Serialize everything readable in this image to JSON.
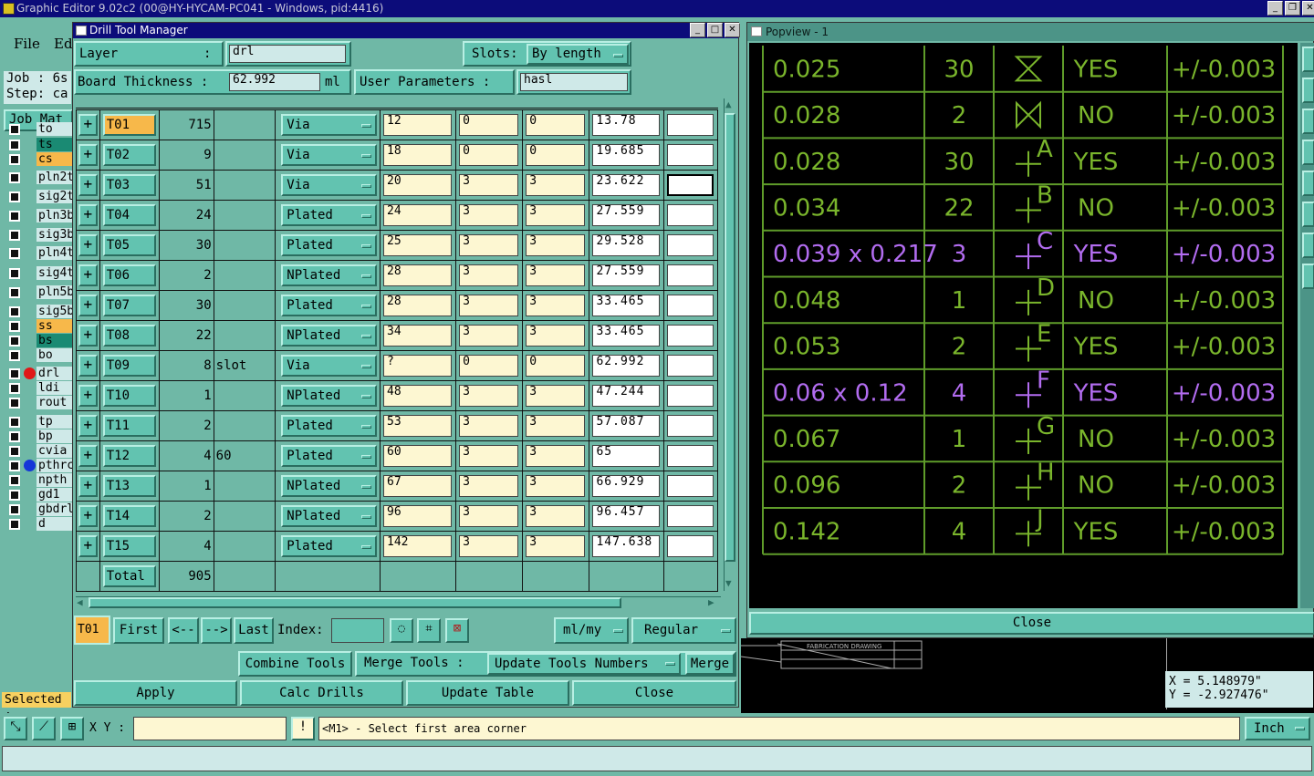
{
  "app_title": "Graphic Editor 9.02c2 (00@HY-HYCAM-PC041 - Windows, pid:4416)",
  "menu": {
    "file": "File",
    "edit": "Ed"
  },
  "job_label": "Job : 6s",
  "step_label": "Step: ca",
  "job_matrix": "Job Mat",
  "layers": [
    "to",
    "ts",
    "cs",
    "pln2t",
    "sig2t",
    "pln3b",
    "sig3b",
    "pln4t",
    "sig4t",
    "pln5b",
    "sig5b",
    "ss",
    "bs",
    "bo",
    "drl",
    "ldi",
    "rout",
    "tp",
    "bp",
    "cvia",
    "pthrc",
    "npth",
    "gd1",
    "gbdrl",
    "d"
  ],
  "selected_label": "Selected :",
  "dialog": {
    "title": "Drill Tool Manager",
    "layer_label": "Layer",
    "layer_colon": ":",
    "layer_value": "drl",
    "slots_label": "Slots:",
    "slots_value": "By length",
    "thickness_label": "Board Thickness :",
    "thickness_value": "62.992",
    "thickness_unit": "ml",
    "user_params_label": "User Parameters :",
    "user_params_value": "hasl",
    "rows": [
      {
        "tool": "T01",
        "count": "715",
        "slot": "",
        "type": "Via",
        "size": "12",
        "p1": "0",
        "p2": "0",
        "finish": "13.78"
      },
      {
        "tool": "T02",
        "count": "9",
        "slot": "",
        "type": "Via",
        "size": "18",
        "p1": "0",
        "p2": "0",
        "finish": "19.685"
      },
      {
        "tool": "T03",
        "count": "51",
        "slot": "",
        "type": "Via",
        "size": "20",
        "p1": "3",
        "p2": "3",
        "finish": "23.622"
      },
      {
        "tool": "T04",
        "count": "24",
        "slot": "",
        "type": "Plated",
        "size": "24",
        "p1": "3",
        "p2": "3",
        "finish": "27.559"
      },
      {
        "tool": "T05",
        "count": "30",
        "slot": "",
        "type": "Plated",
        "size": "25",
        "p1": "3",
        "p2": "3",
        "finish": "29.528"
      },
      {
        "tool": "T06",
        "count": "2",
        "slot": "",
        "type": "NPlated",
        "size": "28",
        "p1": "3",
        "p2": "3",
        "finish": "27.559"
      },
      {
        "tool": "T07",
        "count": "30",
        "slot": "",
        "type": "Plated",
        "size": "28",
        "p1": "3",
        "p2": "3",
        "finish": "33.465"
      },
      {
        "tool": "T08",
        "count": "22",
        "slot": "",
        "type": "NPlated",
        "size": "34",
        "p1": "3",
        "p2": "3",
        "finish": "33.465"
      },
      {
        "tool": "T09",
        "count": "8",
        "slot": "slot",
        "type": "Via",
        "size": "?",
        "p1": "0",
        "p2": "0",
        "finish": "62.992"
      },
      {
        "tool": "T10",
        "count": "1",
        "slot": "",
        "type": "NPlated",
        "size": "48",
        "p1": "3",
        "p2": "3",
        "finish": "47.244"
      },
      {
        "tool": "T11",
        "count": "2",
        "slot": "",
        "type": "Plated",
        "size": "53",
        "p1": "3",
        "p2": "3",
        "finish": "57.087"
      },
      {
        "tool": "T12",
        "count": "4",
        "slot": "60",
        "type": "Plated",
        "size": "60",
        "p1": "3",
        "p2": "3",
        "finish": "65"
      },
      {
        "tool": "T13",
        "count": "1",
        "slot": "",
        "type": "NPlated",
        "size": "67",
        "p1": "3",
        "p2": "3",
        "finish": "66.929"
      },
      {
        "tool": "T14",
        "count": "2",
        "slot": "",
        "type": "NPlated",
        "size": "96",
        "p1": "3",
        "p2": "3",
        "finish": "96.457"
      },
      {
        "tool": "T15",
        "count": "4",
        "slot": "",
        "type": "Plated",
        "size": "142",
        "p1": "3",
        "p2": "3",
        "finish": "147.638"
      }
    ],
    "total_label": "Total",
    "total_value": "905",
    "current_tool": "T01",
    "nav": {
      "first": "First",
      "prev": "<--",
      "next": "-->",
      "last": "Last",
      "index": "Index:"
    },
    "units_value": "ml/my",
    "mode_value": "Regular",
    "combine": "Combine Tools",
    "merge_tools": "Merge Tools :",
    "update_numbers": "Update Tools Numbers",
    "merge": "Merge",
    "apply": "Apply",
    "calc": "Calc Drills",
    "update_table": "Update Table",
    "close": "Close"
  },
  "popview": {
    "title": "Popview - 1",
    "close": "Close",
    "rows": [
      {
        "size": "0.025",
        "qty": "30",
        "sym": "hourglass",
        "plated": "YES",
        "tol": "+/-0.003",
        "color": "green"
      },
      {
        "size": "0.028",
        "qty": "2",
        "sym": "bowtie",
        "plated": "NO",
        "tol": "+/-0.003",
        "color": "green"
      },
      {
        "size": "0.028",
        "qty": "30",
        "sym": "A",
        "plated": "YES",
        "tol": "+/-0.003",
        "color": "green"
      },
      {
        "size": "0.034",
        "qty": "22",
        "sym": "B",
        "plated": "NO",
        "tol": "+/-0.003",
        "color": "green"
      },
      {
        "size": "0.039 x 0.217",
        "qty": "3",
        "sym": "C",
        "plated": "YES",
        "tol": "+/-0.003",
        "color": "purple"
      },
      {
        "size": "0.048",
        "qty": "1",
        "sym": "D",
        "plated": "NO",
        "tol": "+/-0.003",
        "color": "green"
      },
      {
        "size": "0.053",
        "qty": "2",
        "sym": "E",
        "plated": "YES",
        "tol": "+/-0.003",
        "color": "green"
      },
      {
        "size": "0.06 x 0.12",
        "qty": "4",
        "sym": "F",
        "plated": "YES",
        "tol": "+/-0.003",
        "color": "purple"
      },
      {
        "size": "0.067",
        "qty": "1",
        "sym": "G",
        "plated": "NO",
        "tol": "+/-0.003",
        "color": "green"
      },
      {
        "size": "0.096",
        "qty": "2",
        "sym": "H",
        "plated": "NO",
        "tol": "+/-0.003",
        "color": "green"
      },
      {
        "size": "0.142",
        "qty": "4",
        "sym": "J",
        "plated": "YES",
        "tol": "+/-0.003",
        "color": "green"
      }
    ],
    "colors": {
      "green": "#7ab52c",
      "purple": "#b26cf0",
      "grid": "#5f9c2a"
    }
  },
  "coords": {
    "x": "X = 5.148979\"",
    "y": "Y = -2.927476\""
  },
  "statusbar": {
    "xy_label": "X Y :",
    "prompt": "<M1> - Select first area corner",
    "units": "Inch"
  },
  "drawing_title": "FABRICATION DRAWING"
}
